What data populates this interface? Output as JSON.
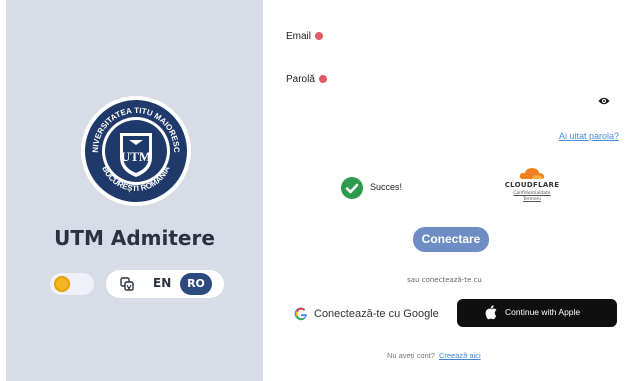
{
  "branding": {
    "title": "UTM Admitere",
    "logo_text_top": "UNIVERSITATEA TITU MAIORESCU",
    "logo_text_bottom": "BUCUREȘTI ROMÂNIA",
    "logo_monogram": "UTM"
  },
  "theme_toggle": {
    "state": "light"
  },
  "language": {
    "icon": "translate-icon",
    "options": [
      "EN",
      "RO"
    ],
    "selected": "RO"
  },
  "form": {
    "email_label": "Email",
    "password_label": "Parolă",
    "email_value": "",
    "password_value": "",
    "forgot_link": "Ai uitat parola?",
    "captcha_status": "Succes!",
    "cloudflare_label": "CLOUDFLARE",
    "cloudflare_links": [
      "Confidențialitate",
      "Termeni"
    ],
    "login_button": "Conectare",
    "alt_login_text": "sau conectează-te cu",
    "google_button": "Conectează-te cu Google",
    "apple_button": "Continue with Apple",
    "signup_prompt": "Nu aveți cont?",
    "signup_link": "Creează aici"
  },
  "colors": {
    "left_panel": "#d7dce6",
    "accent_blue": "#2c4a7d",
    "button_blue": "#6e8dc4",
    "required_dot": "#e05a64",
    "success_green": "#2e9a4c",
    "link": "#4a8fd8"
  }
}
